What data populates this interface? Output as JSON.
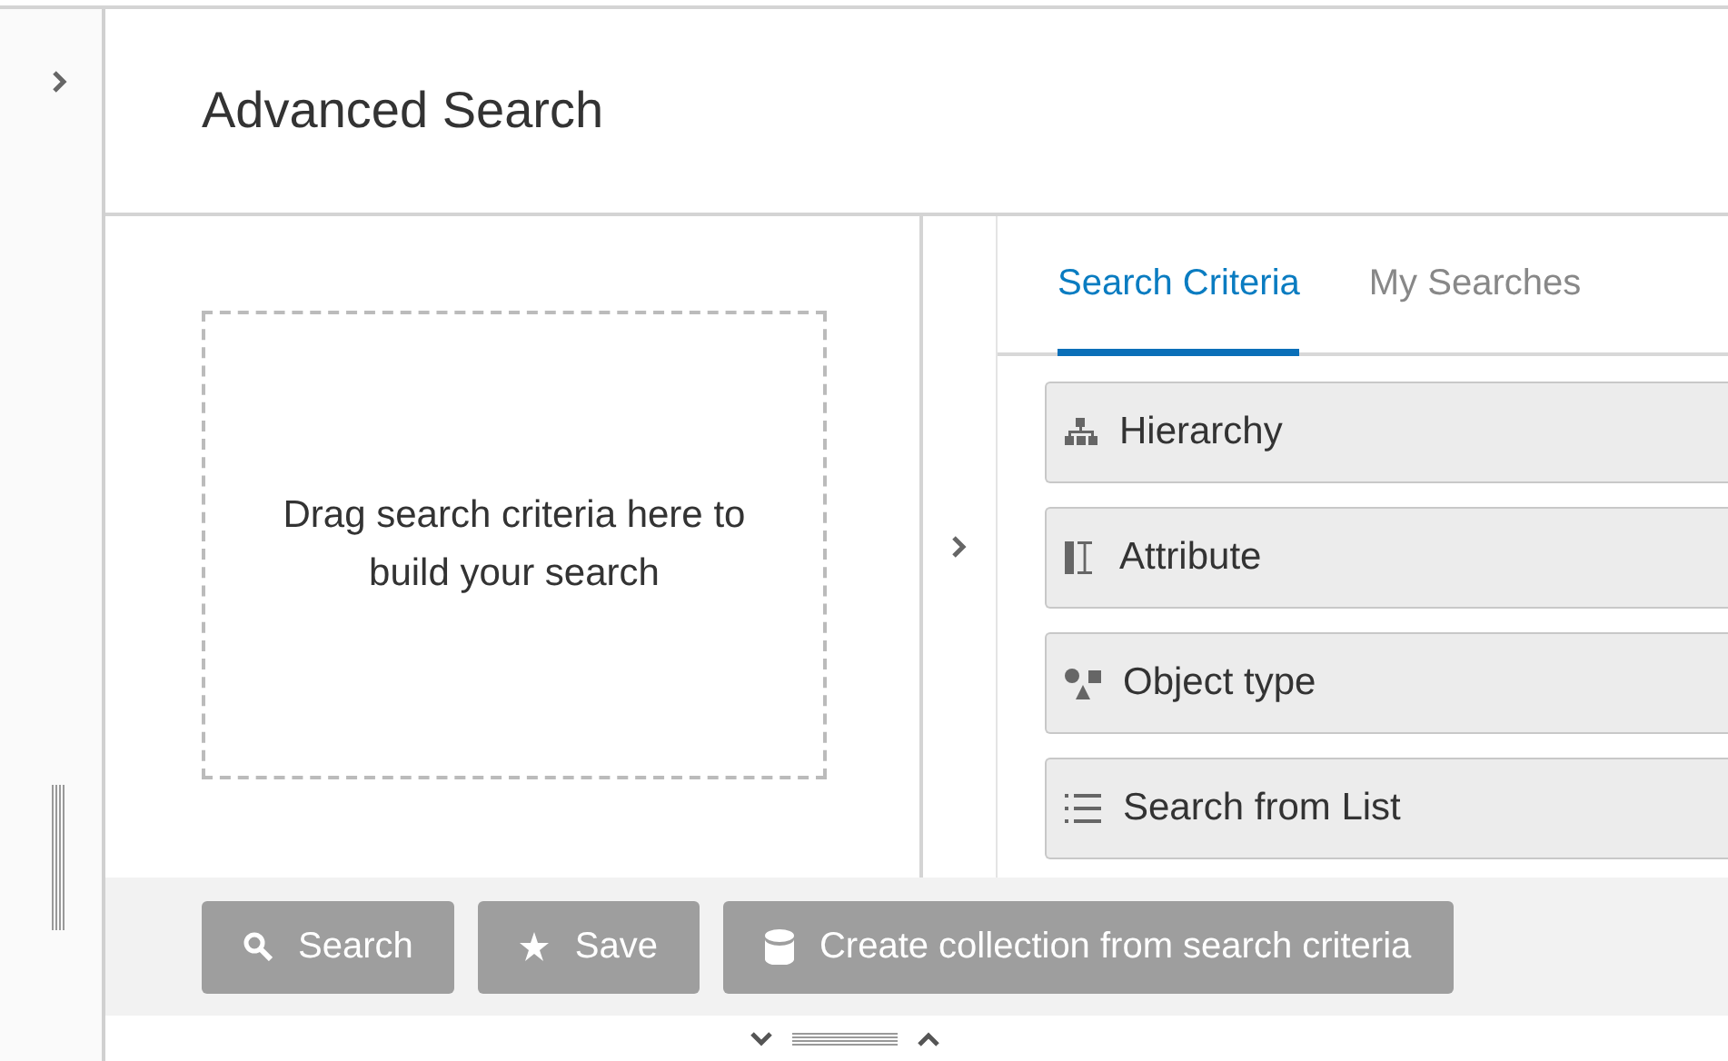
{
  "header": {
    "title": "Advanced Search"
  },
  "drop_zone": {
    "text": "Drag search criteria here to build your search"
  },
  "tabs": [
    {
      "label": "Search Criteria",
      "selected": true
    },
    {
      "label": "My Searches",
      "selected": false
    }
  ],
  "criteria": [
    {
      "kind": "hierarchy",
      "label": "Hierarchy"
    },
    {
      "kind": "attribute",
      "label": "Attribute"
    },
    {
      "kind": "object-type",
      "label": "Object type"
    },
    {
      "kind": "list",
      "label": "Search from List"
    }
  ],
  "buttons": [
    {
      "kind": "search",
      "label": "Search",
      "disabled": true
    },
    {
      "kind": "save",
      "label": "Save",
      "disabled": true
    },
    {
      "kind": "collection",
      "label": "Create collection from search criteria",
      "disabled": true
    }
  ]
}
